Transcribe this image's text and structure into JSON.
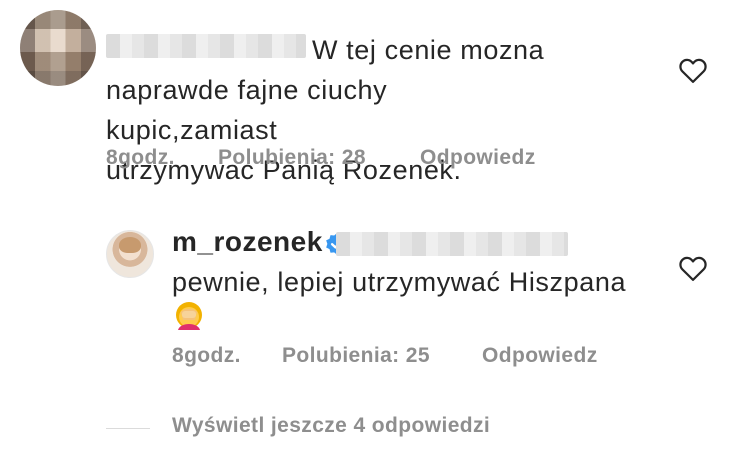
{
  "comment": {
    "text_line1": "W tej cenie mozna",
    "text_line2": "naprawde fajne ciuchy kupic,zamiast",
    "text_line3": "utrzymywac Panią Rozenek.",
    "time": "8godz.",
    "likes": "Polubienia: 28",
    "reply": "Odpowiedz"
  },
  "reply_comment": {
    "username": "m_rozenek",
    "text": "pewnie, lepiej utrzymywać Hiszpana",
    "time": "8godz.",
    "likes": "Polubienia: 25",
    "reply": "Odpowiedz"
  },
  "more_replies": "Wyświetl jeszcze 4 odpowiedzi",
  "icons": {
    "like": "heart-outline-icon",
    "verified": "verified-badge-icon",
    "emoji": "woman-facepalming-emoji"
  },
  "colors": {
    "text": "#262626",
    "secondary": "#8e8e8e",
    "verified": "#3897f0"
  }
}
